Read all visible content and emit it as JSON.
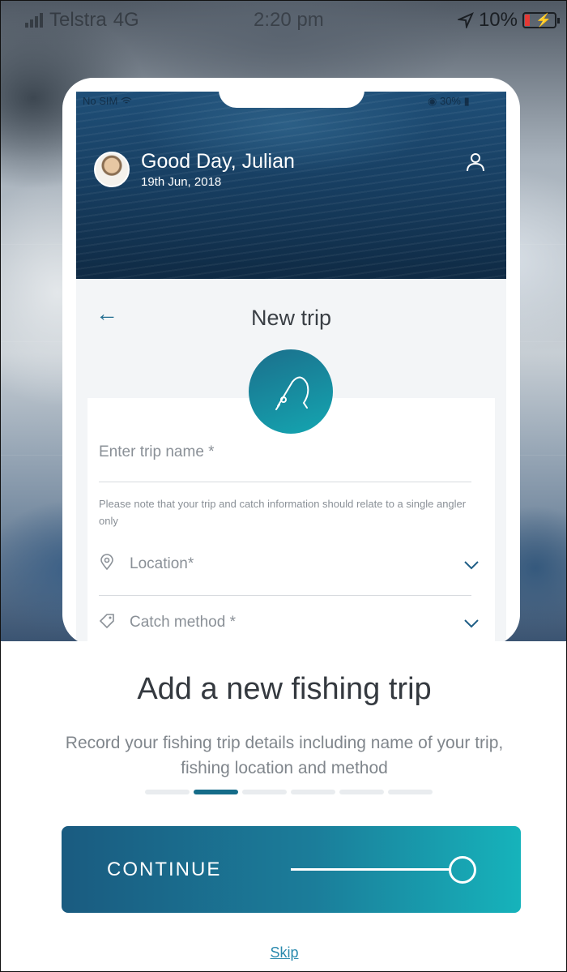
{
  "status_bar": {
    "carrier": "Telstra",
    "network": "4G",
    "time": "2:20 pm",
    "battery": "10%"
  },
  "phone_status": {
    "carrier": "No SIM",
    "battery": "30%"
  },
  "header": {
    "greeting": "Good Day, Julian",
    "date": "19th Jun, 2018"
  },
  "page": {
    "title": "New trip"
  },
  "form": {
    "trip_name_placeholder": "Enter trip name *",
    "note": "Please note that your trip and catch information should relate to a single angler only",
    "location_label": "Location*",
    "catch_method_label": "Catch method *"
  },
  "onboarding": {
    "headline": "Add a new fishing trip",
    "description": "Record your fishing trip details including name of your trip, fishing location and method",
    "step_count": 6,
    "active_step": 2
  },
  "buttons": {
    "continue": "CONTINUE",
    "skip": "Skip"
  },
  "colors": {
    "accent": "#156c89",
    "gradient_start": "#1a5b80",
    "gradient_end": "#16b3bb",
    "link": "#2a8aae"
  },
  "icons": [
    "wifi-icon",
    "profile-icon",
    "back-arrow-icon",
    "fishing-rod-icon",
    "location-pin-icon",
    "tag-icon",
    "chevron-down-icon"
  ]
}
